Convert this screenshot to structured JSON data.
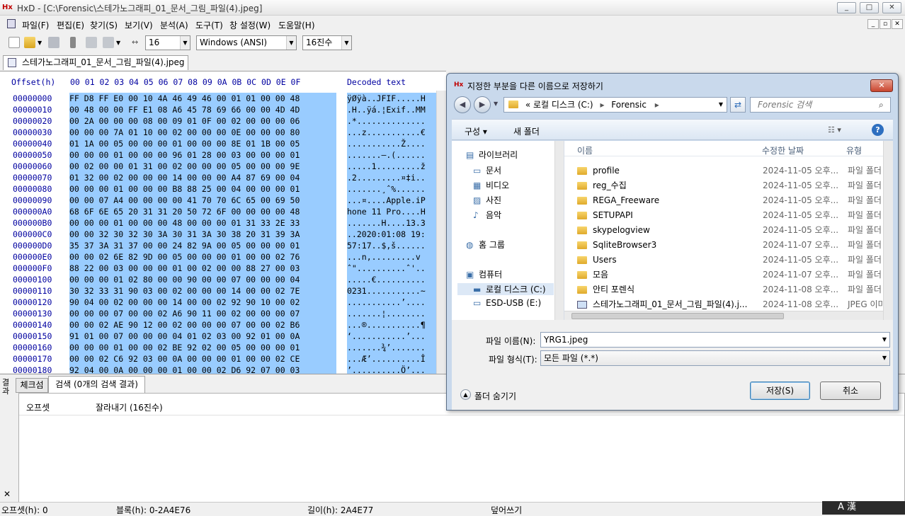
{
  "window": {
    "title": "HxD - [C:\\Forensic\\스테가노그래피_01_문서_그림_파일(4).jpeg]",
    "min": "_",
    "max": "□",
    "close": "✕"
  },
  "menu": [
    "파일(F)",
    "편집(E)",
    "찾기(S)",
    "보기(V)",
    "분석(A)",
    "도구(T)",
    "창 설정(W)",
    "도움말(H)"
  ],
  "toolbar": {
    "bytes_per_row": "16",
    "charset": "Windows (ANSI)",
    "offset_base": "16진수"
  },
  "tab": {
    "label": "스테가노그래피_01_문서_그림_파일(4).jpeg"
  },
  "hex": {
    "header_offset": "Offset(h)",
    "header_columns": "00 01 02 03 04 05 06 07 08 09 0A 0B 0C 0D 0E 0F",
    "header_decoded": "Decoded text",
    "rows": [
      {
        "o": "00000000",
        "h": "FF D8 FF E0 00 10 4A 46 49 46 00 01 01 00 00 48",
        "t": "ÿØÿà..JFIF.....H"
      },
      {
        "o": "00000010",
        "h": "00 48 00 00 FF E1 08 A6 45 78 69 66 00 00 4D 4D",
        "t": ".H..ÿá.¦Exif..MM"
      },
      {
        "o": "00000020",
        "h": "00 2A 00 00 00 08 00 09 01 0F 00 02 00 00 00 06",
        "t": ".*.............."
      },
      {
        "o": "00000030",
        "h": "00 00 00 7A 01 10 00 02 00 00 00 0E 00 00 00 80",
        "t": "...z...........€"
      },
      {
        "o": "00000040",
        "h": "01 1A 00 05 00 00 00 01 00 00 00 8E 01 1B 00 05",
        "t": "...........Ž...."
      },
      {
        "o": "00000050",
        "h": "00 00 00 01 00 00 00 96 01 28 00 03 00 00 00 01",
        "t": ".......–.(......"
      },
      {
        "o": "00000060",
        "h": "00 02 00 00 01 31 00 02 00 00 00 05 00 00 00 9E",
        "t": ".....1.........ž"
      },
      {
        "o": "00000070",
        "h": "01 32 00 02 00 00 00 14 00 00 00 A4 87 69 00 04",
        "t": ".2.........¤‡i.."
      },
      {
        "o": "00000080",
        "h": "00 00 00 01 00 00 00 B8 88 25 00 04 00 00 00 01",
        "t": ".......¸ˆ%......"
      },
      {
        "o": "00000090",
        "h": "00 00 07 A4 00 00 00 00 41 70 70 6C 65 00 69 50",
        "t": "...¤....Apple.iP"
      },
      {
        "o": "000000A0",
        "h": "68 6F 6E 65 20 31 31 20 50 72 6F 00 00 00 00 48",
        "t": "hone 11 Pro....H"
      },
      {
        "o": "000000B0",
        "h": "00 00 00 01 00 00 00 48 00 00 00 01 31 33 2E 33",
        "t": ".......H....13.3"
      },
      {
        "o": "000000C0",
        "h": "00 00 32 30 32 30 3A 30 31 3A 30 38 20 31 39 3A",
        "t": "..2020:01:08 19:"
      },
      {
        "o": "000000D0",
        "h": "35 37 3A 31 37 00 00 24 82 9A 00 05 00 00 00 01",
        "t": "57:17..$‚š......"
      },
      {
        "o": "000000E0",
        "h": "00 00 02 6E 82 9D 00 05 00 00 00 01 00 00 02 76",
        "t": "...n‚.........v"
      },
      {
        "o": "000000F0",
        "h": "88 22 00 03 00 00 00 01 00 02 00 00 88 27 00 03",
        "t": "ˆ\"..........ˆ'.."
      },
      {
        "o": "00000100",
        "h": "00 00 00 01 02 80 00 00 90 00 00 07 00 00 00 04",
        "t": ".....€.........."
      },
      {
        "o": "00000110",
        "h": "30 32 33 31 90 03 00 02 00 00 00 14 00 00 02 7E",
        "t": "0231...........~"
      },
      {
        "o": "00000120",
        "h": "90 04 00 02 00 00 00 14 00 00 02 92 90 10 00 02",
        "t": "...........’...."
      },
      {
        "o": "00000130",
        "h": "00 00 00 07 00 00 02 A6 90 11 00 02 00 00 00 07",
        "t": ".......¦........"
      },
      {
        "o": "00000140",
        "h": "00 00 02 AE 90 12 00 02 00 00 00 07 00 00 02 B6",
        "t": "...®...........¶"
      },
      {
        "o": "00000150",
        "h": "91 01 00 07 00 00 00 04 01 02 03 00 92 01 00 0A",
        "t": "‘...........’..."
      },
      {
        "o": "00000160",
        "h": "00 00 00 01 00 00 02 BE 92 02 00 05 00 00 00 01",
        "t": ".......¾’......."
      },
      {
        "o": "00000170",
        "h": "00 00 02 C6 92 03 00 0A 00 00 00 01 00 00 02 CE",
        "t": "...Æ’..........Î"
      },
      {
        "o": "00000180",
        "h": "92 04 00 0A 00 00 00 01 00 00 02 D6 92 07 00 03",
        "t": "’..........Ö’..."
      }
    ]
  },
  "bottom": {
    "side_label": "결과",
    "tabs": [
      "체크섬",
      "검색 (0개의 검색 결과)"
    ],
    "columns": [
      "오프셋",
      "잘라내기 (16진수)"
    ],
    "close": "✕"
  },
  "status": {
    "offset": "오프셋(h): 0",
    "block": "블록(h): 0-2A4E76",
    "length": "길이(h): 2A4E77",
    "mode": "덮어쓰기"
  },
  "tray": "A 漢",
  "dialog": {
    "title": "지정한 부분을 다른 이름으로 저장하기",
    "close": "✕",
    "address": [
      "« 로컬 디스크 (C:)",
      "Forensic"
    ],
    "search_placeholder": "Forensic 검색",
    "organize": "구성 ▾",
    "new_folder": "새 폴더",
    "help": "?",
    "nav": [
      {
        "label": "라이브러리",
        "icon": "library-icon",
        "indent": 0
      },
      {
        "label": "문서",
        "icon": "documents-icon",
        "indent": 1
      },
      {
        "label": "비디오",
        "icon": "video-icon",
        "indent": 1
      },
      {
        "label": "사진",
        "icon": "pictures-icon",
        "indent": 1
      },
      {
        "label": "음악",
        "icon": "music-icon",
        "indent": 1
      },
      {
        "label": "홈 그룹",
        "icon": "homegroup-icon",
        "indent": 0
      },
      {
        "label": "컴퓨터",
        "icon": "computer-icon",
        "indent": 0
      },
      {
        "label": "로컬 디스크 (C:)",
        "icon": "disk-icon",
        "indent": 1
      },
      {
        "label": "ESD-USB (E:)",
        "icon": "usb-icon",
        "indent": 1
      }
    ],
    "list_headers": [
      "이름",
      "수정한 날짜",
      "유형"
    ],
    "files": [
      {
        "name": "profile",
        "date": "2024-11-05 오후...",
        "type": "파일 폴더",
        "kind": "folder"
      },
      {
        "name": "reg_수집",
        "date": "2024-11-05 오후...",
        "type": "파일 폴더",
        "kind": "folder"
      },
      {
        "name": "REGA_Freeware",
        "date": "2024-11-05 오후...",
        "type": "파일 폴더",
        "kind": "folder"
      },
      {
        "name": "SETUPAPI",
        "date": "2024-11-05 오후...",
        "type": "파일 폴더",
        "kind": "folder"
      },
      {
        "name": "skypelogview",
        "date": "2024-11-05 오후...",
        "type": "파일 폴더",
        "kind": "folder"
      },
      {
        "name": "SqliteBrowser3",
        "date": "2024-11-07 오후...",
        "type": "파일 폴더",
        "kind": "folder"
      },
      {
        "name": "Users",
        "date": "2024-11-05 오후...",
        "type": "파일 폴더",
        "kind": "folder"
      },
      {
        "name": "모음",
        "date": "2024-11-07 오후...",
        "type": "파일 폴더",
        "kind": "folder"
      },
      {
        "name": "안티 포렌식",
        "date": "2024-11-08 오후...",
        "type": "파일 폴더",
        "kind": "folder"
      },
      {
        "name": "스테가노그래피_01_문서_그림_파일(4).j...",
        "date": "2024-11-08 오후...",
        "type": "JPEG 이미",
        "kind": "image"
      }
    ],
    "filename_label": "파일 이름(N):",
    "filename_value": "YRG1.jpeg",
    "filetype_label": "파일 형식(T):",
    "filetype_value": "모든 파일 (*.*)",
    "hide_folders": "폴더 숨기기",
    "save": "저장(S)",
    "cancel": "취소"
  }
}
